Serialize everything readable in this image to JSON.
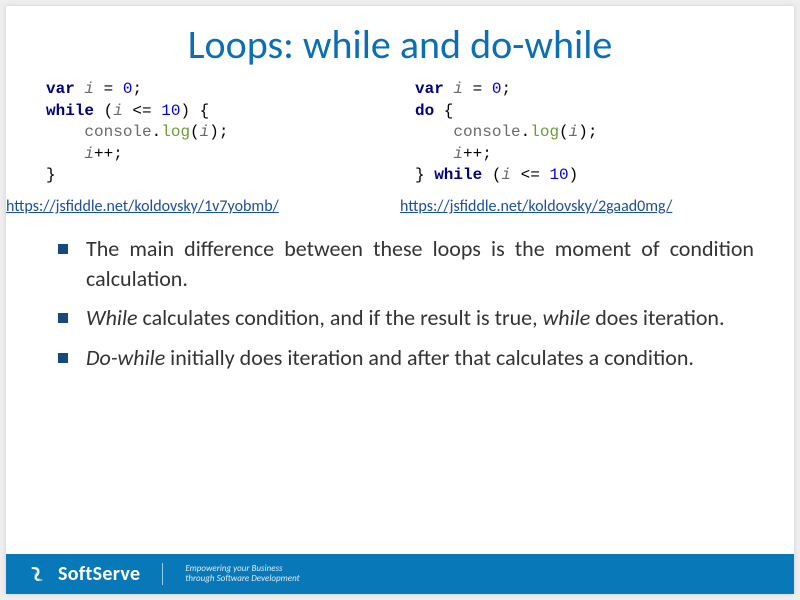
{
  "title": "Loops: while and do-while",
  "code_left_html": "<span class=\"kw\">var</span> <span class=\"id\">i</span> = <span class=\"num\">0</span>;\n<span class=\"kw\">while</span> (<span class=\"id\">i</span> &lt;= <span class=\"num\">10</span>) {\n    <span class=\"obj\">console</span>.<span class=\"fn\">log</span>(<span class=\"id\">i</span>);\n    <span class=\"id\">i</span>++;\n}",
  "code_right_html": "<span class=\"kw\">var</span> <span class=\"id\">i</span> = <span class=\"num\">0</span>;\n<span class=\"kw\">do</span> {\n    <span class=\"obj\">console</span>.<span class=\"fn\">log</span>(<span class=\"id\">i</span>);\n    <span class=\"id\">i</span>++;\n} <span class=\"kw\">while</span> (<span class=\"id\">i</span> &lt;= <span class=\"num\">10</span>)",
  "links": {
    "left": "https://jsfiddle.net/koldovsky/1v7yobmb/",
    "right": "https://jsfiddle.net/koldovsky/2gaad0mg/"
  },
  "bullets": [
    {
      "html": "The main difference between these loops is the moment of condition calculation."
    },
    {
      "html": "<span class=\"ital\">While</span> calculates condition, and if the result is true, <span class=\"ital\">while</span> does iteration."
    },
    {
      "html": "<span class=\"ital\">Do-while</span> initially does iteration and after that calculates a condition."
    }
  ],
  "footer": {
    "brand": "SoftServe",
    "tagline_line1": "Empowering your Business",
    "tagline_line2": "through Software Development"
  }
}
